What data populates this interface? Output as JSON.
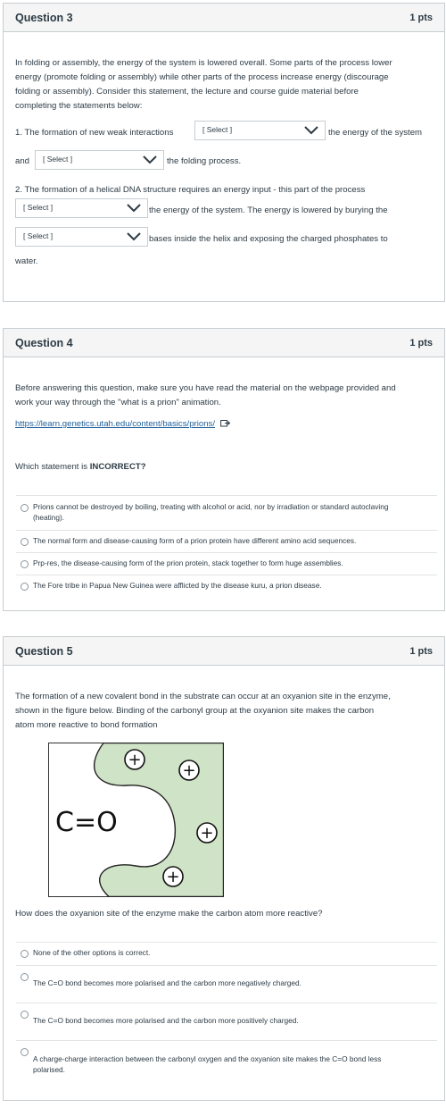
{
  "q3": {
    "title": "Question 3",
    "pts": "1 pts",
    "intro_lines": [
      "In folding or assembly, the energy of the system is lowered overall. Some parts of the process lower",
      "energy (promote folding or assembly) while other parts of the process increase energy (discourage",
      "folding or assembly). Consider this statement, the lecture and course guide material before",
      "completing the statements below:"
    ],
    "s1_prefix": "1. The formation of new weak interactions",
    "s1_suffix": "the energy of the system",
    "s1_and": "and",
    "s1_end": "the folding process.",
    "s2_line1": "2. The formation of a helical DNA structure requires an energy input - this part of the process",
    "s2_after1": "the energy of the system. The energy is lowered by burying the",
    "s2_after2": "bases inside the helix and exposing the charged phosphates to",
    "s2_end": "water.",
    "select_placeholder": "[ Select ]"
  },
  "q4": {
    "title": "Question 4",
    "pts": "1 pts",
    "intro_lines": [
      "Before answering this question, make sure you have read the material on the webpage provided and",
      "work your way through the \"what is a prion\" animation."
    ],
    "link_text": "https://learn.genetics.utah.edu/content/basics/prions/",
    "question_prefix": "Which statement is ",
    "question_emph": "INCORRECT?",
    "options": [
      [
        "Prions cannot be destroyed by boiling, treating with alcohol or acid, nor by irradiation or standard autoclaving",
        "(heating)."
      ],
      [
        "The normal form and disease-causing form of a prion protein have different amino acid sequences."
      ],
      [
        "Prp-res, the disease-causing form of the prion protein, stack together to form huge assemblies."
      ],
      [
        "The Fore tribe in Papua New Guinea were afflicted by the disease kuru, a prion disease."
      ]
    ]
  },
  "q5": {
    "title": "Question 5",
    "pts": "1 pts",
    "intro_lines": [
      "The formation of a new covalent bond in the substrate can occur at an oxyanion site in the enzyme,",
      "shown in the figure below. Binding of the carbonyl group at the oxyanion site makes the carbon",
      "atom more reactive to bond formation"
    ],
    "figure": {
      "carbonyl_label": "C=O",
      "plus": "+",
      "site_color": "#cfe3c6"
    },
    "question": "How does the oxyanion site of the enzyme make the carbon atom more reactive?",
    "options": [
      [
        "None of the other options is correct."
      ],
      [
        "The C=O bond becomes more polarised and the carbon more negatively charged."
      ],
      [
        "The C=O bond becomes more polarised and the carbon more positively charged."
      ],
      [
        "A charge-charge interaction between the carbonyl oxygen and the oxyanion site makes the C=O bond less",
        "polarised."
      ]
    ]
  }
}
